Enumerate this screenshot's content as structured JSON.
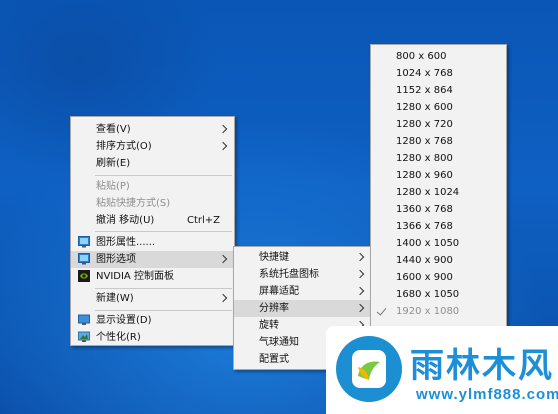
{
  "context_menu": {
    "items": [
      {
        "label": "查看(V)",
        "submenu": true
      },
      {
        "label": "排序方式(O)",
        "submenu": true
      },
      {
        "label": "刷新(E)"
      },
      {
        "label": "粘贴(P)",
        "disabled": true
      },
      {
        "label": "粘贴快捷方式(S)",
        "disabled": true
      },
      {
        "label": "撤消 移动(U)",
        "shortcut": "Ctrl+Z"
      },
      {
        "label": "图形属性......",
        "icon": "graphics-properties-icon"
      },
      {
        "label": "图形选项",
        "icon": "graphics-options-icon",
        "submenu": true,
        "highlighted": true
      },
      {
        "label": "NVIDIA 控制面板",
        "icon": "nvidia-icon"
      },
      {
        "label": "新建(W)",
        "submenu": true
      },
      {
        "label": "显示设置(D)",
        "icon": "display-settings-icon"
      },
      {
        "label": "个性化(R)",
        "icon": "personalize-icon"
      }
    ]
  },
  "graphics_options_submenu": {
    "items": [
      {
        "label": "快捷键",
        "submenu": true
      },
      {
        "label": "系统托盘图标",
        "submenu": true
      },
      {
        "label": "屏幕适配",
        "submenu": true
      },
      {
        "label": "分辨率",
        "submenu": true,
        "highlighted": true
      },
      {
        "label": "旋转",
        "submenu": true
      },
      {
        "label": "气球通知"
      },
      {
        "label": "配置式"
      }
    ]
  },
  "resolution_submenu": {
    "items": [
      {
        "label": "800 x 600"
      },
      {
        "label": "1024 x 768"
      },
      {
        "label": "1152 x 864"
      },
      {
        "label": "1280 x 600"
      },
      {
        "label": "1280 x 720"
      },
      {
        "label": "1280 x 768"
      },
      {
        "label": "1280 x 800"
      },
      {
        "label": "1280 x 960"
      },
      {
        "label": "1280 x 1024"
      },
      {
        "label": "1360 x 768"
      },
      {
        "label": "1366 x 768"
      },
      {
        "label": "1400 x 1050"
      },
      {
        "label": "1440 x 900"
      },
      {
        "label": "1600 x 900"
      },
      {
        "label": "1680 x 1050"
      },
      {
        "label": "1920 x 1080",
        "checked": true,
        "disabled": true
      }
    ]
  },
  "watermark": {
    "title": "雨林木风",
    "url": "www.ylmf888.com"
  },
  "colors": {
    "desktop_blue": "#0e60c2",
    "menu_bg": "#f2f2f2",
    "highlight": "#d9d9d9",
    "watermark_blue": "#1d8fd8"
  }
}
